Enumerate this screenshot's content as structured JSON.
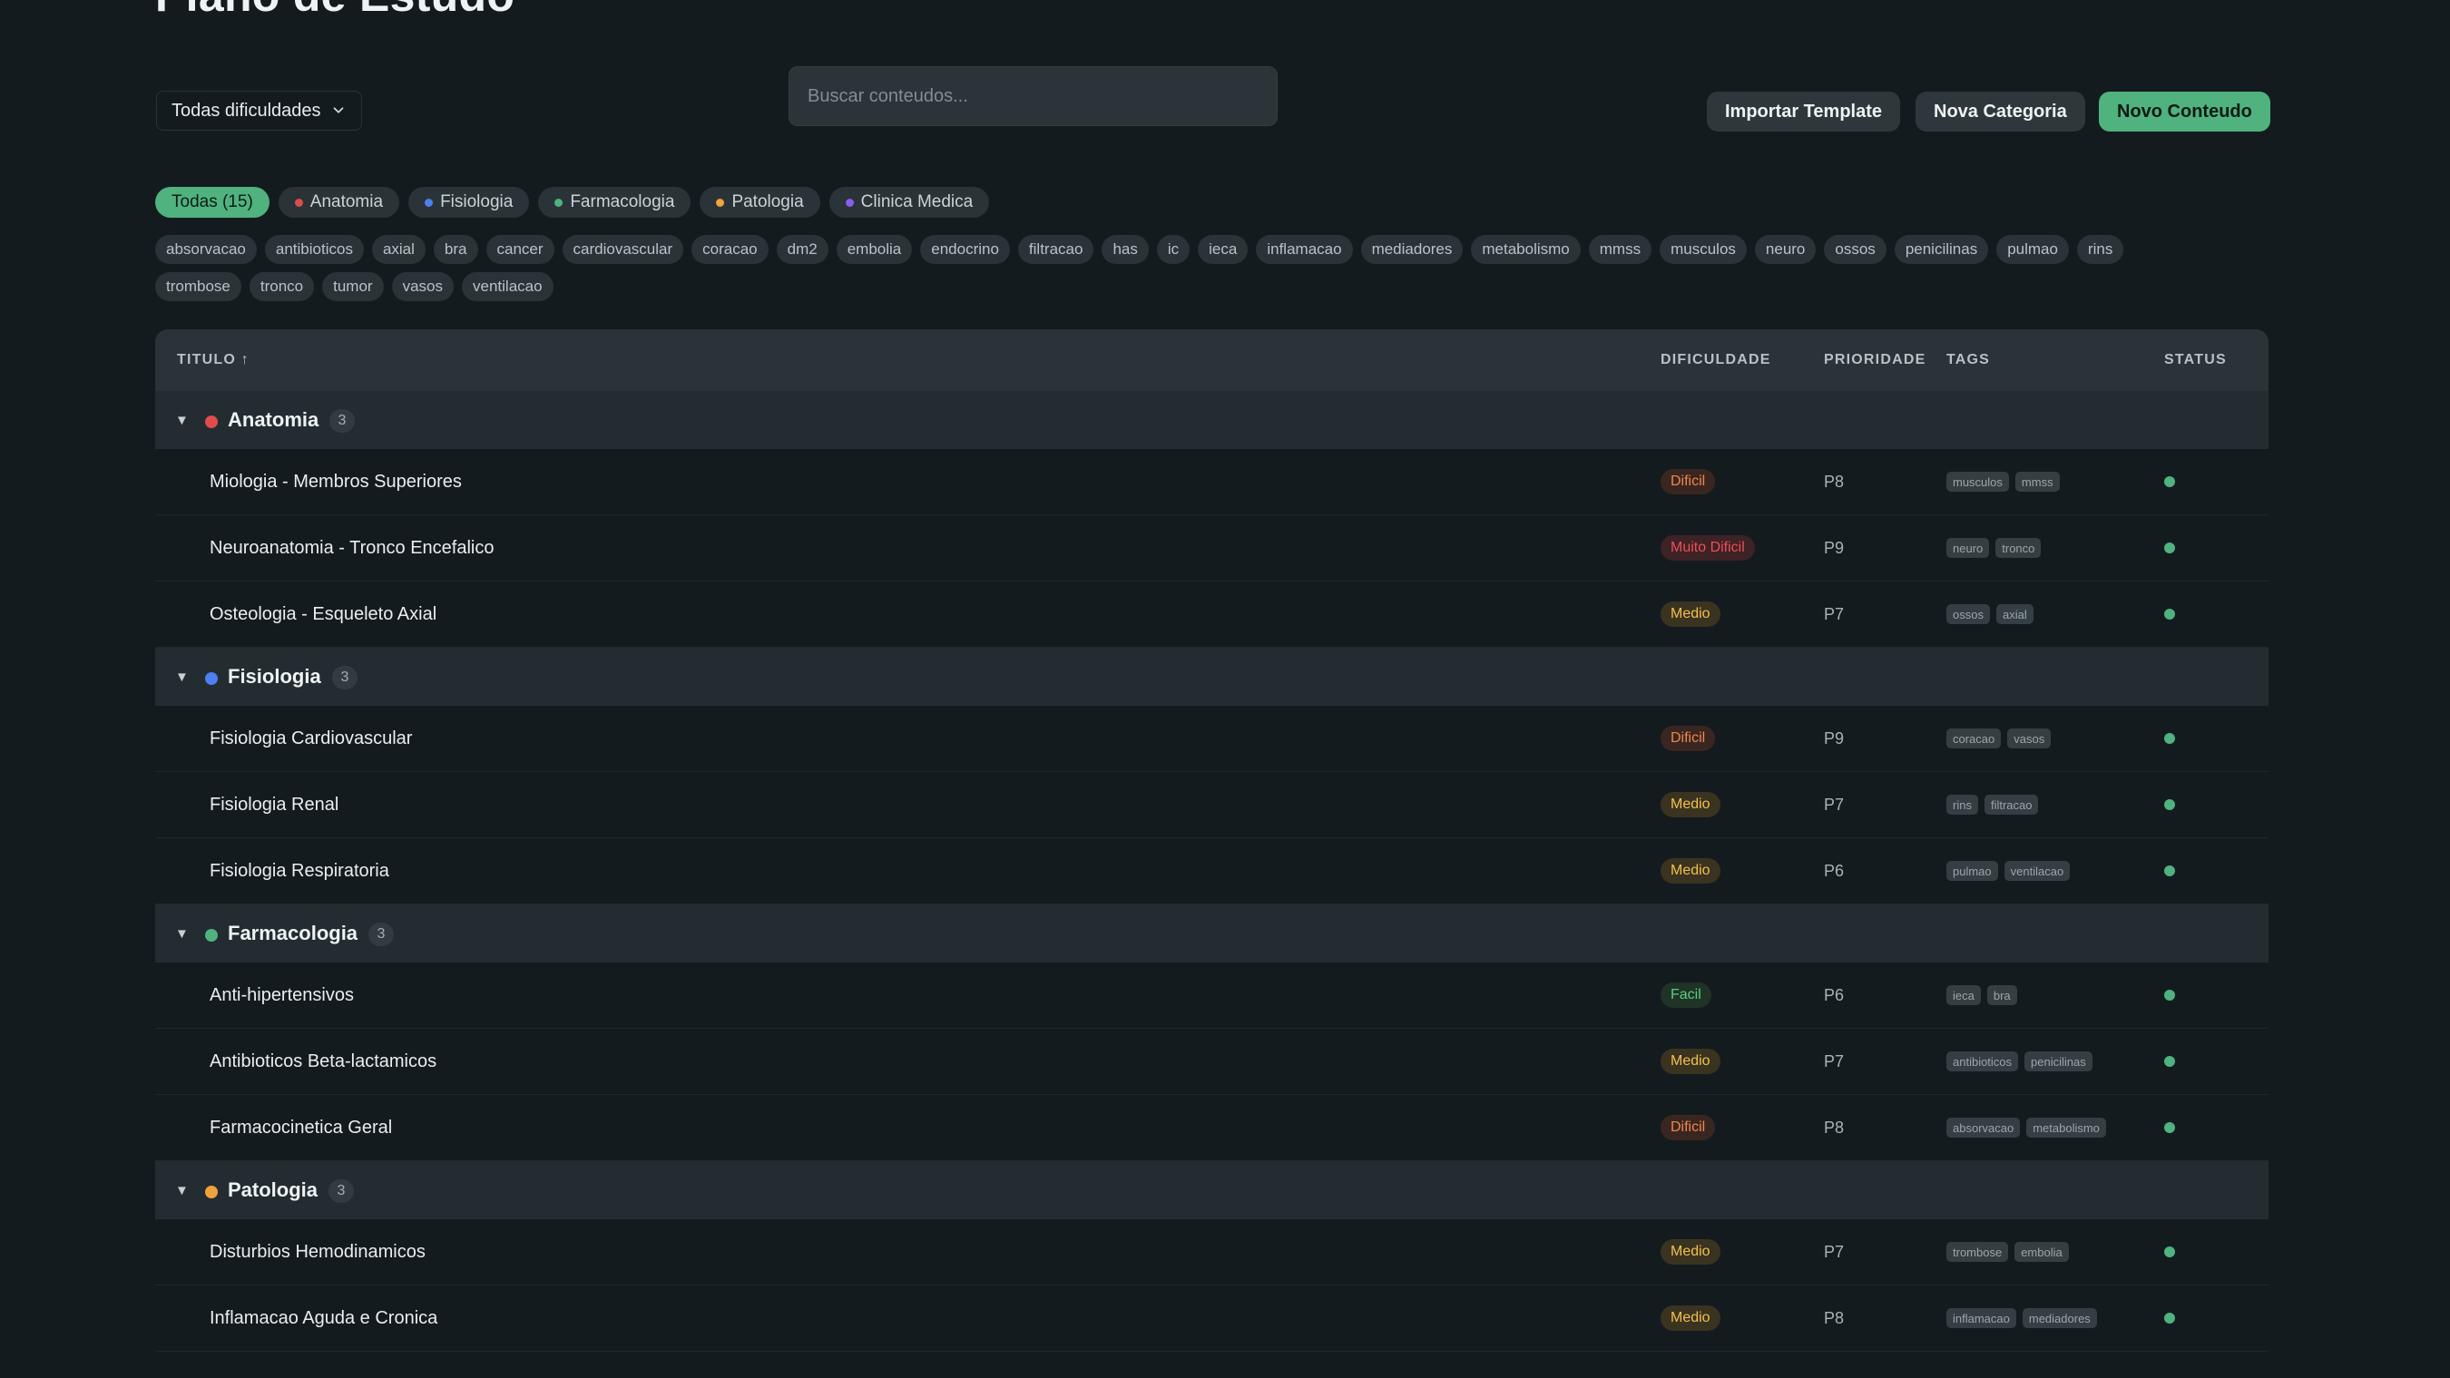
{
  "page": {
    "title": "Plano de Estudo"
  },
  "filters": {
    "difficulty_label": "Todas dificuldades",
    "search_placeholder": "Buscar conteudos..."
  },
  "actions": {
    "import_label": "Importar Template",
    "new_category_label": "Nova Categoria",
    "new_content_label": "Novo Conteudo"
  },
  "categories": [
    {
      "label": "Todas (15)",
      "active": true,
      "color": ""
    },
    {
      "label": "Anatomia",
      "active": false,
      "color": "#e04c4c"
    },
    {
      "label": "Fisiologia",
      "active": false,
      "color": "#4e7ff0"
    },
    {
      "label": "Farmacologia",
      "active": false,
      "color": "#4fb27f"
    },
    {
      "label": "Patologia",
      "active": false,
      "color": "#f0a23c"
    },
    {
      "label": "Clinica Medica",
      "active": false,
      "color": "#8a5cf0"
    }
  ],
  "tags": [
    "absorvacao",
    "antibioticos",
    "axial",
    "bra",
    "cancer",
    "cardiovascular",
    "coracao",
    "dm2",
    "embolia",
    "endocrino",
    "filtracao",
    "has",
    "ic",
    "ieca",
    "inflamacao",
    "mediadores",
    "metabolismo",
    "mmss",
    "musculos",
    "neuro",
    "ossos",
    "penicilinas",
    "pulmao",
    "rins",
    "trombose",
    "tronco",
    "tumor",
    "vasos",
    "ventilacao"
  ],
  "table": {
    "headers": {
      "title": "TITULO ↑",
      "difficulty": "DIFICULDADE",
      "priority": "PRIORIDADE",
      "tags": "TAGS",
      "status": "STATUS"
    },
    "groups": [
      {
        "name": "Anatomia",
        "count": "3",
        "color": "#e04c4c",
        "items": [
          {
            "title": "Miologia - Membros Superiores",
            "difficulty": "Dificil",
            "level": "dificil",
            "priority": "P8",
            "tags": [
              "musculos",
              "mmss"
            ]
          },
          {
            "title": "Neuroanatomia - Tronco Encefalico",
            "difficulty": "Muito Dificil",
            "level": "muito",
            "priority": "P9",
            "tags": [
              "neuro",
              "tronco"
            ]
          },
          {
            "title": "Osteologia - Esqueleto Axial",
            "difficulty": "Medio",
            "level": "medio",
            "priority": "P7",
            "tags": [
              "ossos",
              "axial"
            ]
          }
        ]
      },
      {
        "name": "Fisiologia",
        "count": "3",
        "color": "#4e7ff0",
        "items": [
          {
            "title": "Fisiologia Cardiovascular",
            "difficulty": "Dificil",
            "level": "dificil",
            "priority": "P9",
            "tags": [
              "coracao",
              "vasos"
            ]
          },
          {
            "title": "Fisiologia Renal",
            "difficulty": "Medio",
            "level": "medio",
            "priority": "P7",
            "tags": [
              "rins",
              "filtracao"
            ]
          },
          {
            "title": "Fisiologia Respiratoria",
            "difficulty": "Medio",
            "level": "medio",
            "priority": "P6",
            "tags": [
              "pulmao",
              "ventilacao"
            ]
          }
        ]
      },
      {
        "name": "Farmacologia",
        "count": "3",
        "color": "#4fb27f",
        "items": [
          {
            "title": "Anti-hipertensivos",
            "difficulty": "Facil",
            "level": "facil",
            "priority": "P6",
            "tags": [
              "ieca",
              "bra"
            ]
          },
          {
            "title": "Antibioticos Beta-lactamicos",
            "difficulty": "Medio",
            "level": "medio",
            "priority": "P7",
            "tags": [
              "antibioticos",
              "penicilinas"
            ]
          },
          {
            "title": "Farmacocinetica Geral",
            "difficulty": "Dificil",
            "level": "dificil",
            "priority": "P8",
            "tags": [
              "absorvacao",
              "metabolismo"
            ]
          }
        ]
      },
      {
        "name": "Patologia",
        "count": "3",
        "color": "#f0a23c",
        "items": [
          {
            "title": "Disturbios Hemodinamicos",
            "difficulty": "Medio",
            "level": "medio",
            "priority": "P7",
            "tags": [
              "trombose",
              "embolia"
            ]
          },
          {
            "title": "Inflamacao Aguda e Cronica",
            "difficulty": "Medio",
            "level": "medio",
            "priority": "P8",
            "tags": [
              "inflamacao",
              "mediadores"
            ]
          }
        ]
      }
    ]
  }
}
